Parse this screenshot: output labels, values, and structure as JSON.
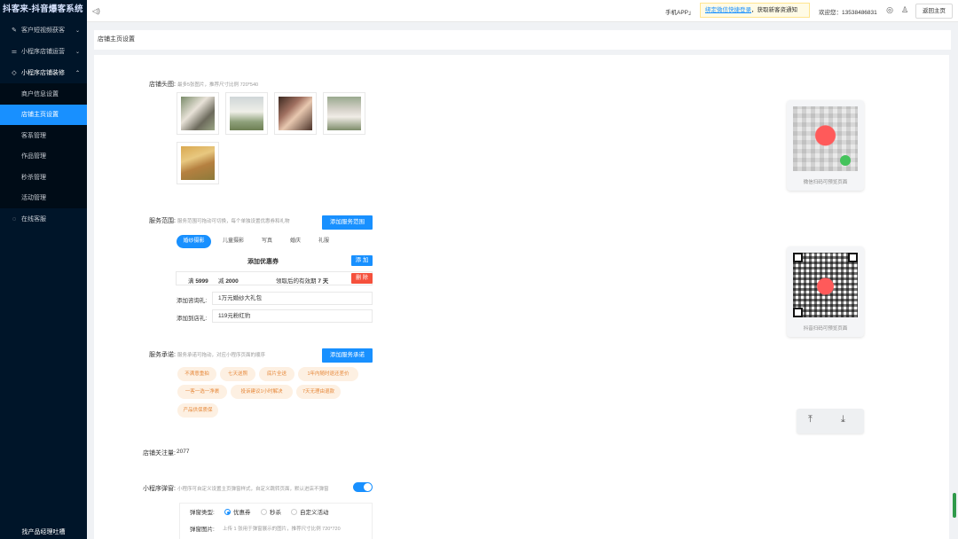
{
  "brand": "抖客来-抖音爆客系统",
  "sidebar": {
    "groups": [
      {
        "icon": "edit-icon",
        "label": "客户短视频获客"
      },
      {
        "icon": "sliders-icon",
        "label": "小程序店铺运营"
      },
      {
        "icon": "tag-icon",
        "label": "小程序店铺装修"
      }
    ],
    "sub_items": [
      "商户信息设置",
      "店铺主页设置",
      "客系管理",
      "作品管理",
      "秒杀管理",
      "活动管理"
    ],
    "active_item": "店铺主页设置",
    "online_service": "在线客服",
    "footer": "找产品经理吐槽"
  },
  "header": {
    "app_link": "手机APP」",
    "notice_link": "绑定微信快捷登录",
    "notice_text": "，获取新客资通知",
    "welcome": "欢迎您：13538486831",
    "back_label": "返回主页"
  },
  "page_title": "店铺主页设置",
  "store_header": {
    "label": "店铺头图:",
    "hint": "最多5张图片，推荐尺寸比例 720*540"
  },
  "service_scope": {
    "label": "服务范围:",
    "hint": "服务范围可拖动可切换，每个单独设置优惠券和礼物",
    "add_button": "添加服务范围",
    "tabs": [
      "婚纱摄影",
      "儿童摄影",
      "写真",
      "婚庆",
      "礼服"
    ],
    "active_tab": "婚纱摄影"
  },
  "coupon": {
    "title": "添加优惠券",
    "add_button": "添 加",
    "full_prefix": "满",
    "full_value": "5999",
    "minus_prefix": "减",
    "minus_value": "2000",
    "valid_prefix": "领取后的有效期",
    "valid_value": "7 天",
    "delete_button": "删 除"
  },
  "gifts": {
    "consult_label": "添加咨询礼:",
    "consult_value": "1万元婚纱大礼包",
    "store_label": "添加到店礼:",
    "store_value": "119元粉红豹"
  },
  "service_promise": {
    "label": "服务承诺:",
    "hint": "服务承诺可拖动，对应小程序页面的顺序",
    "add_button": "添加服务承诺",
    "items": [
      "不满意重拍",
      "七天送照",
      "底片全送",
      "1年内随时退还差价",
      "一客一选一净裹",
      "投诉建议1小时解决",
      "7天无理由退款",
      "产品供保质保"
    ]
  },
  "followers": {
    "label": "店铺关注量:",
    "value": "2077"
  },
  "popup": {
    "label": "小程序弹窗:",
    "hint": "小程序可自定义设置主页弹窗样式，自定义跳转页面，默认进店不弹窗",
    "enabled": true,
    "type_label": "弹窗类型:",
    "types": [
      "优惠券",
      "秒杀",
      "自定义活动"
    ],
    "selected_type": "优惠券",
    "image_label": "弹窗图片:",
    "image_hint": "上传 1 张用于弹窗展示的图片，推荐尺寸比例 720*720"
  },
  "qr": {
    "wechat_caption": "微信扫码可预览页面",
    "douyin_caption": "抖音扫码可预览页面"
  },
  "colors": {
    "sidebar_bg": "#001529",
    "primary": "#1890ff",
    "danger": "#f5503c",
    "promise_bg": "#fdf0e2",
    "promise_text": "#e6883a"
  }
}
